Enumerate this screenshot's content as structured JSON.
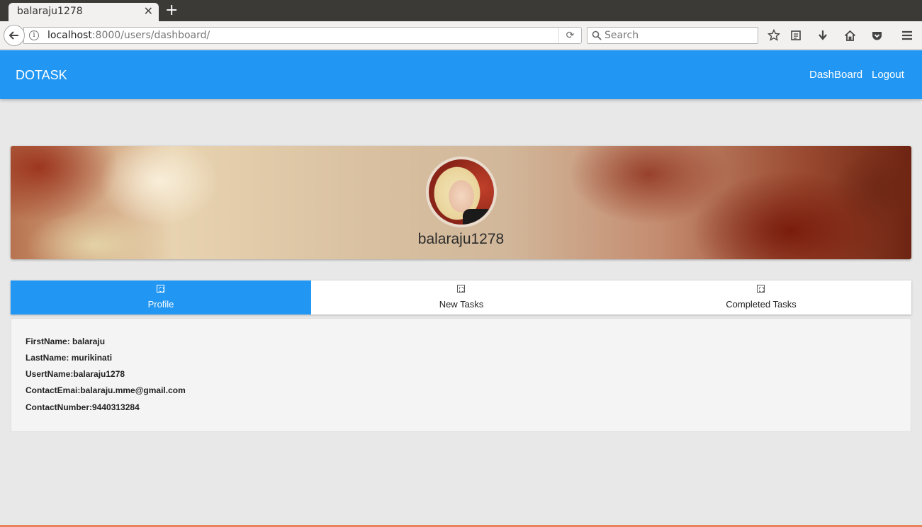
{
  "browser": {
    "tab_title": "balaraju1278",
    "url_host": "localhost",
    "url_rest": ":8000/users/dashboard/",
    "search_placeholder": "Search"
  },
  "app": {
    "brand": "DOTASK",
    "nav": [
      "DashBoard",
      "Logout"
    ],
    "accent_color": "#2196f3"
  },
  "profile": {
    "username": "balaraju1278"
  },
  "tabs": [
    {
      "label": "Profile",
      "active": true
    },
    {
      "label": "New Tasks",
      "active": false
    },
    {
      "label": "Completed Tasks",
      "active": false
    }
  ],
  "info": [
    "FirstName: balaraju",
    "LastName: murikinati",
    "UsertName:balaraju1278",
    "ContactEmai:balaraju.mme@gmail.com",
    "ContactNumber:9440313284"
  ]
}
